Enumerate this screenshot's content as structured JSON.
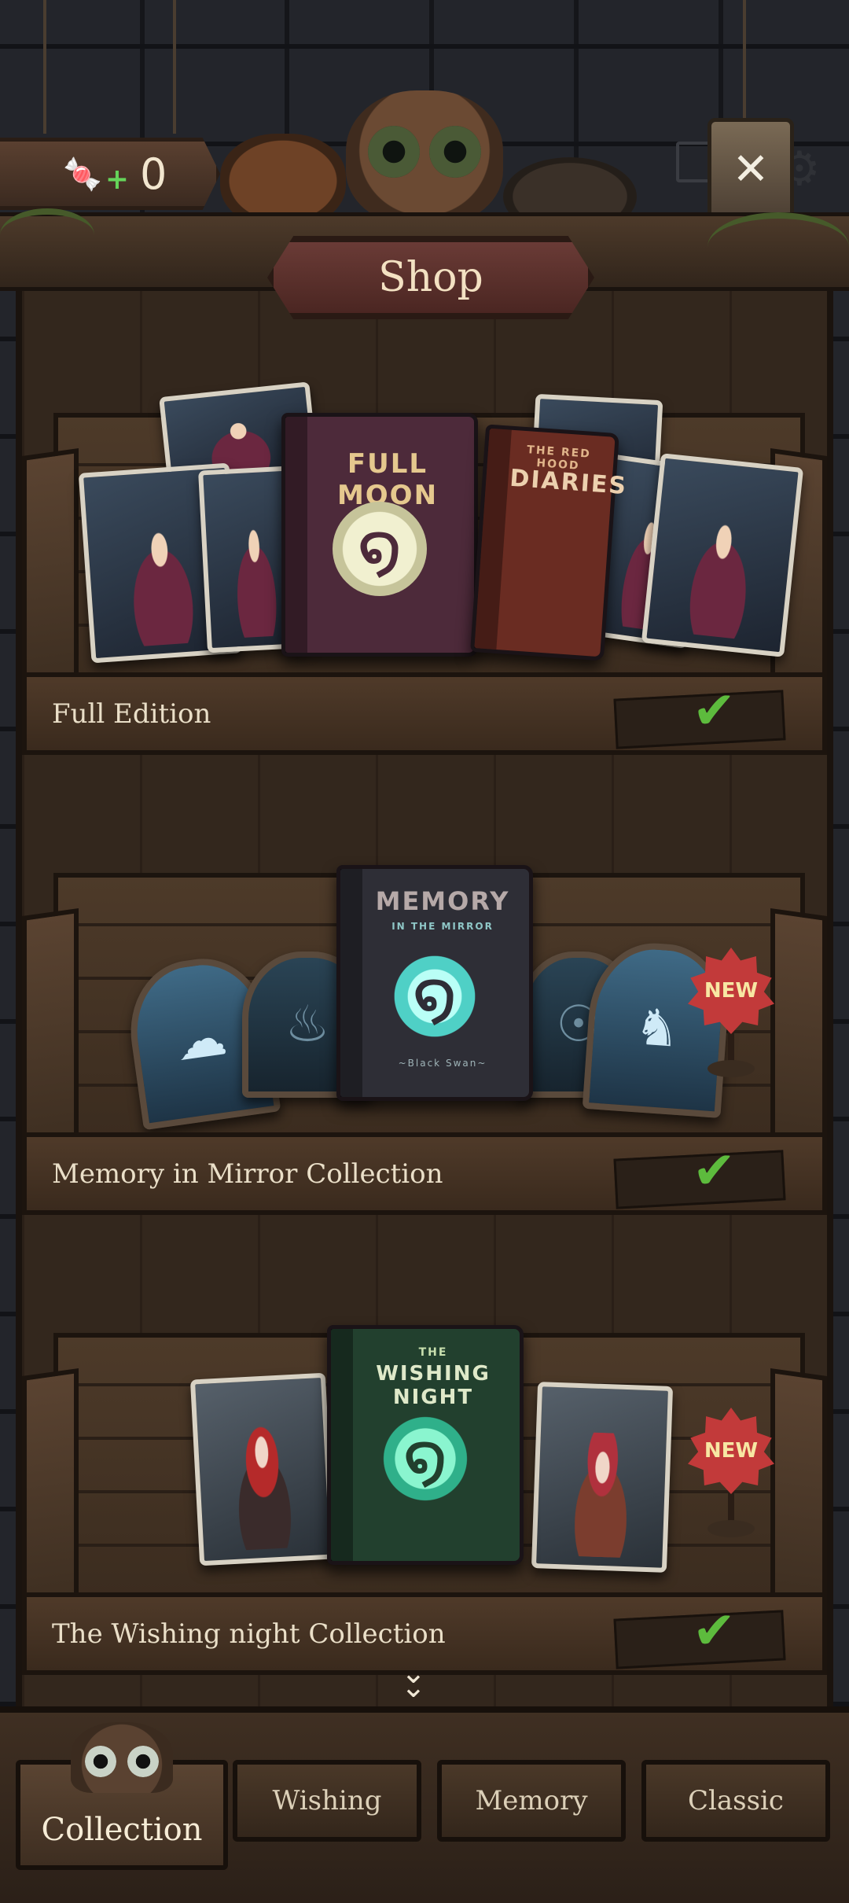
{
  "header": {
    "currency": {
      "icon": "candy-icon",
      "value": "0"
    },
    "close_icon": "close-icon"
  },
  "shop": {
    "title": "Shop"
  },
  "shelves": [
    {
      "label": "Full Edition",
      "owned": true,
      "book": {
        "title": "FULL MOON",
        "color": "#4d2a3a"
      },
      "book2": {
        "title": "DIARIES",
        "subtitle": "THE RED HOOD",
        "color": "#6a2c22"
      },
      "new": false
    },
    {
      "label": "Memory in Mirror Collection",
      "owned": true,
      "book": {
        "title": "MEMORY",
        "subtitle": "IN THE MIRROR",
        "footer": "~Black Swan~",
        "color": "#2e2e36"
      },
      "new": true,
      "new_label": "NEW"
    },
    {
      "label": "The Wishing night Collection",
      "owned": true,
      "book": {
        "title": "WISHING NIGHT",
        "subtitle": "THE",
        "color": "#22402e"
      },
      "new": true,
      "new_label": "NEW"
    }
  ],
  "bottom_nav": {
    "tabs": [
      {
        "label": "Collection",
        "active": true
      },
      {
        "label": "Wishing",
        "active": false
      },
      {
        "label": "Memory",
        "active": false
      },
      {
        "label": "Classic",
        "active": false
      }
    ]
  }
}
